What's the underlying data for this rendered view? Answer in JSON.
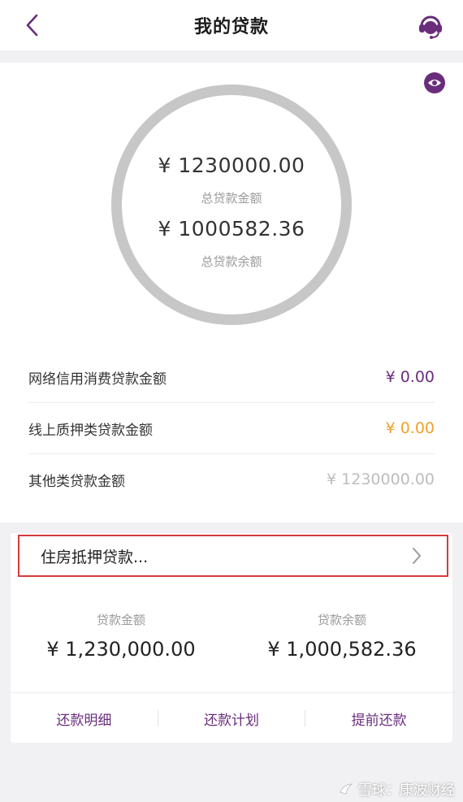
{
  "header": {
    "title": "我的贷款",
    "back_icon": "chevron-left-icon",
    "support_icon": "headset-icon"
  },
  "summary": {
    "visibility_icon": "eye-icon",
    "total_amount": "¥ 1230000.00",
    "total_label": "总贷款金额",
    "balance_amount": "¥ 1000582.36",
    "balance_label": "总贷款余额",
    "rows": [
      {
        "label": "网络信用消费贷款金额",
        "value": "¥ 0.00",
        "color": "#6a2d7c"
      },
      {
        "label": "线上质押类贷款金额",
        "value": "¥ 0.00",
        "color": "#f0a22b"
      },
      {
        "label": "其他类贷款金额",
        "value": "¥ 1230000.00",
        "color": "#bdbdbd"
      }
    ]
  },
  "loan": {
    "title": "住房抵押贷款...",
    "amount_label": "贷款金额",
    "amount_value": "¥ 1,230,000.00",
    "balance_label": "贷款余额",
    "balance_value": "¥ 1,000,582.36",
    "actions": [
      "还款明细",
      "还款计划",
      "提前还款"
    ]
  },
  "watermark": "雪球：康波财经",
  "colors": {
    "accent": "#6a2d7c",
    "orange": "#f0a22b",
    "highlight_border": "#d63a3a"
  }
}
